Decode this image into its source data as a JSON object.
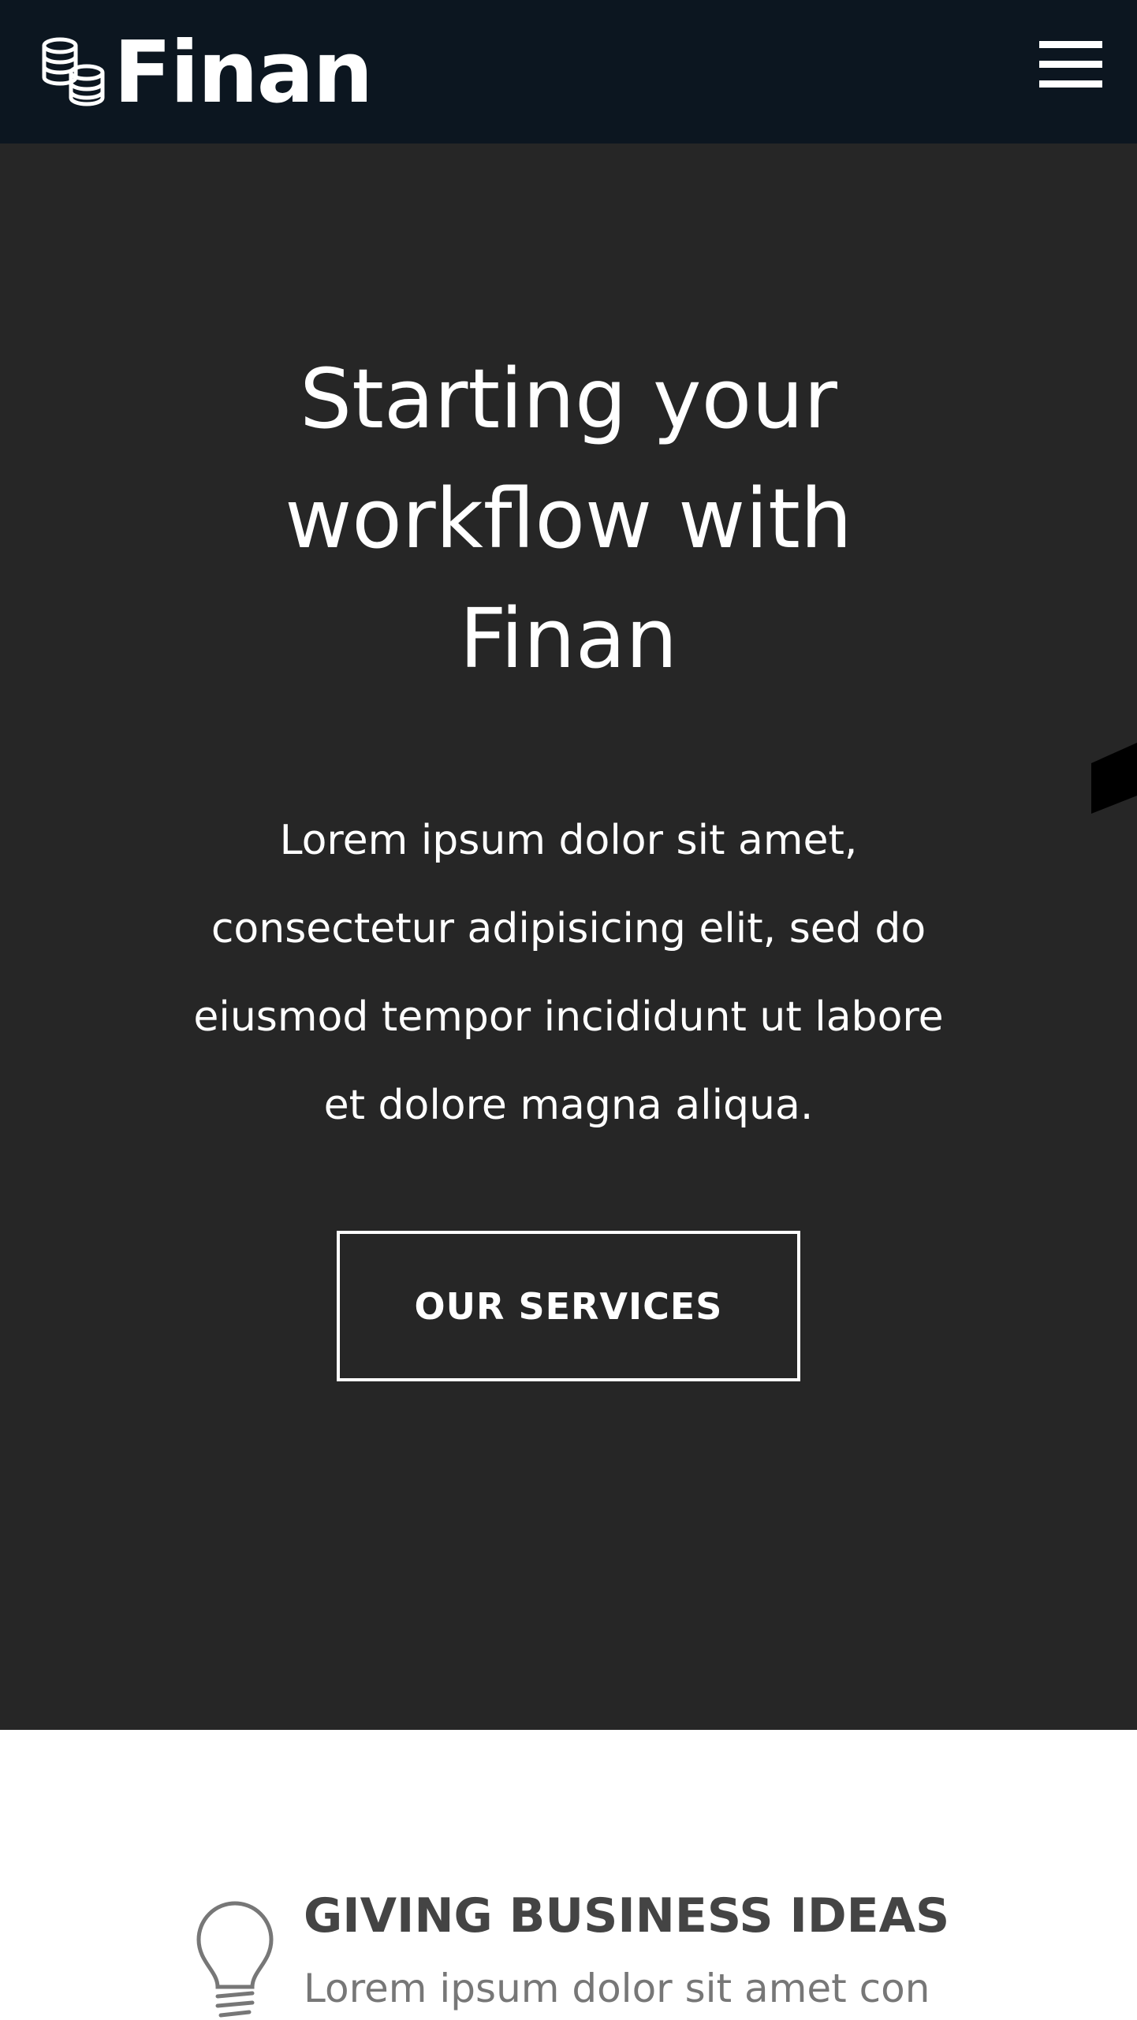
{
  "header": {
    "logo_text": "Finan",
    "logo_icon": "coins-stack-icon",
    "menu_icon": "hamburger-menu-icon",
    "background": "#0c1620"
  },
  "hero": {
    "title_line1": "Starting your",
    "title_line2": "workflow with",
    "title_line3": "Finan",
    "text_line1": "Lorem ipsum dolor sit amet,",
    "text_line2": "consectetur adipisicing elit, sed do",
    "text_line3": "eiusmod tempor incididunt ut labore",
    "text_line4": "et dolore magna aliqua.",
    "button_label": "OUR SERVICES",
    "background": "#262626"
  },
  "features": {
    "items": [
      {
        "icon": "lightbulb-icon",
        "title": "GIVING BUSINESS IDEAS",
        "text": "Lorem ipsum dolor sit amet con"
      }
    ]
  }
}
